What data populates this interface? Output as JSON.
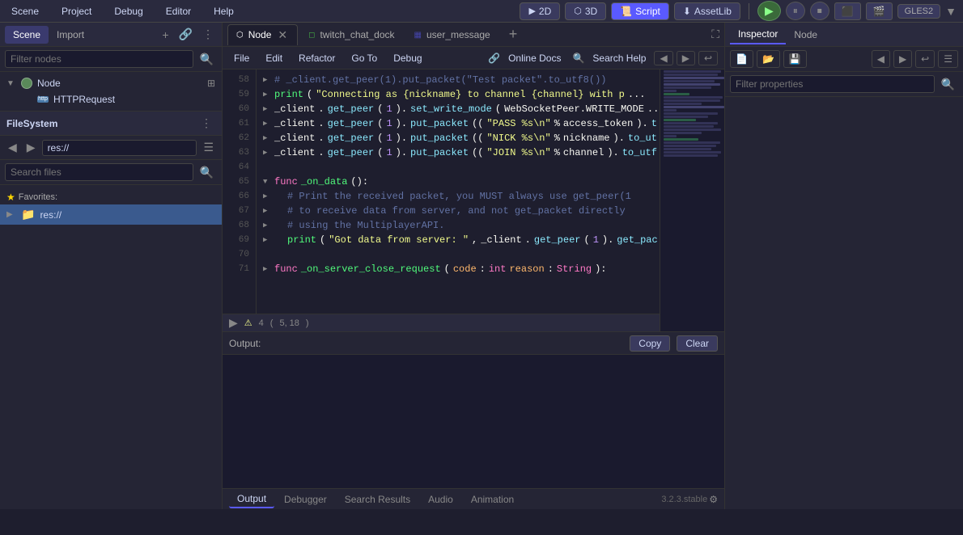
{
  "menubar": {
    "items": [
      "Scene",
      "Project",
      "Debug",
      "Editor",
      "Help"
    ]
  },
  "toolbar": {
    "mode_2d": "2D",
    "mode_3d": "3D",
    "script": "Script",
    "assetlib": "AssetLib",
    "gles": "GLES2"
  },
  "scene_panel": {
    "tab_scene": "Scene",
    "tab_import": "Import",
    "filter_placeholder": "Filter nodes",
    "tree": [
      {
        "label": "Node",
        "type": "node",
        "level": 0,
        "expanded": true
      },
      {
        "label": "HTTPRequest",
        "type": "http",
        "level": 1
      }
    ]
  },
  "filesystem_panel": {
    "title": "FileSystem",
    "path": "res://",
    "search_placeholder": "Search files",
    "favorites_label": "Favorites:",
    "items": [
      {
        "label": "res://",
        "type": "folder",
        "selected": true
      }
    ]
  },
  "editor_tabs": [
    {
      "label": "Node",
      "icon": "⬡",
      "closeable": true,
      "active": true
    },
    {
      "label": "twitch_chat_dock",
      "icon": "◻",
      "closeable": false,
      "active": false
    },
    {
      "label": "user_message",
      "icon": "▦",
      "closeable": false,
      "active": false
    }
  ],
  "editor_toolbar": {
    "file": "File",
    "edit": "Edit",
    "refactor": "Refactor",
    "go_to": "Go To",
    "debug": "Debug",
    "online_docs": "Online Docs",
    "search_help": "Search Help"
  },
  "code": {
    "lines": [
      {
        "num": 58,
        "text": "# _client.get_peer(1).put_packet(\"Test packet\".to_utf8())",
        "type": "comment"
      },
      {
        "num": 59,
        "text": "print(\"Connecting as {nickname} to channel {channel} with p",
        "type": "code",
        "fold": true
      },
      {
        "num": 60,
        "text": "_client.get_peer(1).set_write_mode(WebSocketPeer.WRITE_MODE",
        "type": "code",
        "fold": true
      },
      {
        "num": 61,
        "text": "_client.get_peer(1).put_packet((\"PASS %s\\n\"%access_token).t",
        "type": "code",
        "fold": true
      },
      {
        "num": 62,
        "text": "_client.get_peer(1).put_packet((\"NICK %s\\n\"%nickname).to_ut",
        "type": "code",
        "fold": true
      },
      {
        "num": 63,
        "text": "_client.get_peer(1).put_packet((\"JOIN %s\\n\"%channel).to_utf",
        "type": "code",
        "fold": true
      },
      {
        "num": 64,
        "text": "",
        "type": "empty"
      },
      {
        "num": 65,
        "text": "func _on_data():",
        "type": "funcdef",
        "fold": true
      },
      {
        "num": 66,
        "text": "# Print the received packet, you MUST always use get_peer(1",
        "type": "comment",
        "fold": true
      },
      {
        "num": 67,
        "text": "# to receive data from server, and not get_packet directly",
        "type": "comment",
        "fold": true
      },
      {
        "num": 68,
        "text": "# using the MultiplayerAPI.",
        "type": "comment",
        "fold": true
      },
      {
        "num": 69,
        "text": "print(\"Got data from server: \", _client.get_peer(1).get_pac",
        "type": "code",
        "fold": true
      },
      {
        "num": 70,
        "text": "",
        "type": "empty"
      },
      {
        "num": 71,
        "text": "func _on_server_close_request(code: int  reason: String):",
        "type": "code",
        "fold": true
      }
    ]
  },
  "status_bar": {
    "warning_count": "4",
    "position": "5, 18"
  },
  "output_panel": {
    "label": "Output:",
    "copy_btn": "Copy",
    "clear_btn": "Clear",
    "tabs": [
      "Output",
      "Debugger",
      "Search Results",
      "Audio",
      "Animation"
    ],
    "active_tab": "Output",
    "version": "3.2.3.stable"
  },
  "inspector_panel": {
    "tab_inspector": "Inspector",
    "tab_node": "Node",
    "filter_placeholder": "Filter properties"
  }
}
